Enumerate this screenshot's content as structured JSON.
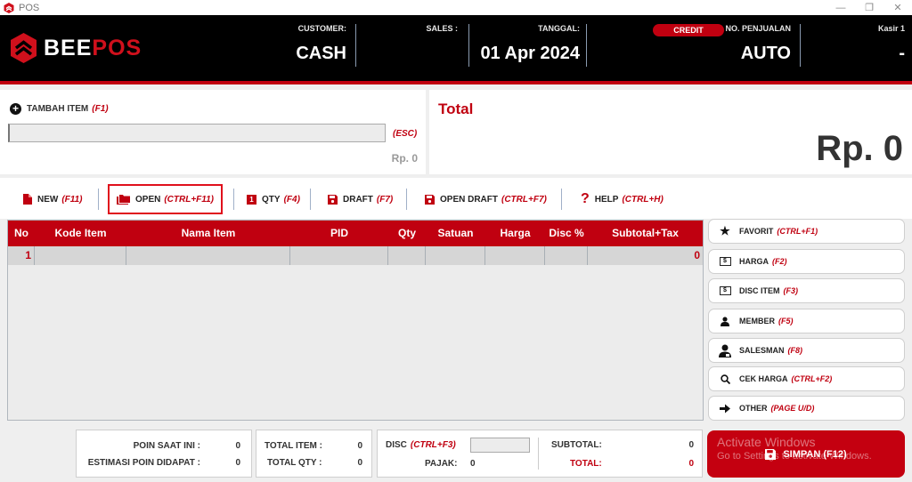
{
  "window": {
    "title": "POS",
    "controls": {
      "minimize": "—",
      "restore": "❐",
      "close": "✕"
    }
  },
  "header": {
    "logo": {
      "part1": "BEE",
      "part2": "POS"
    },
    "customer": {
      "label": "CUSTOMER:",
      "value": "CASH"
    },
    "sales": {
      "label": "SALES :",
      "value": ""
    },
    "date": {
      "label": "TANGGAL:",
      "value": "01 Apr 2024"
    },
    "credit_badge": "CREDIT",
    "sale_no": {
      "label": "NO. PENJUALAN",
      "value": "AUTO"
    },
    "cashier": {
      "label": "Kasir 1",
      "value": "-"
    }
  },
  "add_item": {
    "title": "TAMBAH ITEM",
    "shortcut": "(F1)",
    "input_value": "",
    "esc_label": "(ESC)",
    "price": "Rp. 0"
  },
  "total_panel": {
    "title": "Total",
    "value": "Rp. 0"
  },
  "toolbar": [
    {
      "label": "NEW",
      "shortcut": "(F11)",
      "icon": "file-icon"
    },
    {
      "label": "OPEN",
      "shortcut": "(CTRL+F11)",
      "icon": "folder-icon",
      "active": true
    },
    {
      "label": "QTY",
      "shortcut": "(F4)",
      "icon": "qty-icon",
      "icon_text": "1"
    },
    {
      "label": "DRAFT",
      "shortcut": "(F7)",
      "icon": "save-icon"
    },
    {
      "label": "OPEN DRAFT",
      "shortcut": "(CTRL+F7)",
      "icon": "save-icon"
    },
    {
      "label": "HELP",
      "shortcut": "(CTRL+H)",
      "icon": "help-icon",
      "icon_text": "?"
    }
  ],
  "grid": {
    "columns": [
      "No",
      "Kode Item",
      "Nama Item",
      "PID",
      "Qty",
      "Satuan",
      "Harga",
      "Disc %",
      "Subtotal+Tax"
    ],
    "rows": [
      {
        "no": "1",
        "kode": "",
        "nama": "",
        "pid": "",
        "qty": "",
        "satuan": "",
        "harga": "",
        "disc": "",
        "subtotal": "0"
      }
    ]
  },
  "side_buttons": [
    {
      "label": "FAVORIT",
      "shortcut": "(CTRL+F1)",
      "icon": "star-icon"
    },
    {
      "label": "HARGA",
      "shortcut": "(F2)",
      "icon": "price-tag-icon"
    },
    {
      "label": "DISC ITEM",
      "shortcut": "(F3)",
      "icon": "discount-icon"
    },
    {
      "label": "MEMBER",
      "shortcut": "(F5)",
      "icon": "user-icon"
    },
    {
      "label": "SALESMAN",
      "shortcut": "(F8)",
      "icon": "salesman-icon"
    },
    {
      "label": "CEK HARGA",
      "shortcut": "(CTRL+F2)",
      "icon": "search-icon"
    },
    {
      "label": "OTHER",
      "shortcut": "(PAGE U/D)",
      "icon": "arrow-right-icon"
    }
  ],
  "summary": {
    "points_now_label": "POIN SAAT INI :",
    "points_now": "0",
    "points_est_label": "ESTIMASI POIN DIDAPAT :",
    "points_est": "0",
    "total_item_label": "TOTAL ITEM :",
    "total_item": "0",
    "total_qty_label": "TOTAL QTY :",
    "total_qty": "0",
    "disc_label": "DISC",
    "disc_shortcut": "(CTRL+F3)",
    "disc_value": "",
    "tax_label": "PAJAK:",
    "tax": "0",
    "subtotal_label": "SUBTOTAL:",
    "subtotal": "0",
    "total_label": "TOTAL:",
    "total": "0"
  },
  "save_button": {
    "label": "SIMPAN (F12)"
  },
  "watermark": {
    "line1": "Activate Windows",
    "line2": "Go to Settings to activate Windows."
  },
  "colors": {
    "brand_red": "#c00010",
    "header_bg": "#000000",
    "panel_bg": "#ffffff",
    "app_bg": "#efefef"
  }
}
